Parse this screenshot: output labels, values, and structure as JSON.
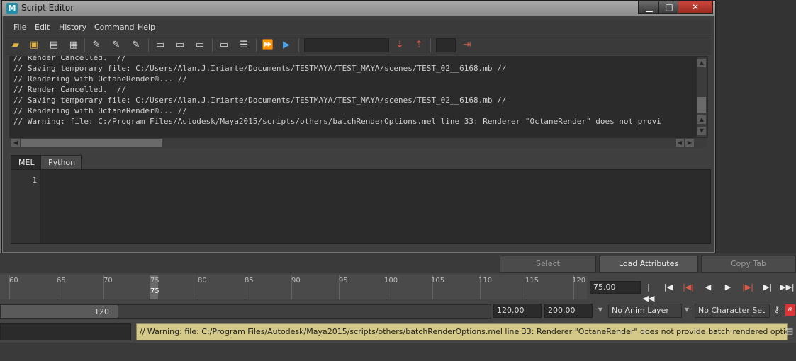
{
  "window": {
    "title": "Script Editor",
    "app_icon": "maya-icon",
    "controls": {
      "minimize": "▁",
      "maximize": "□",
      "close": "✕"
    }
  },
  "menu": [
    "File",
    "Edit",
    "History",
    "Command",
    "Help"
  ],
  "toolbar_icons": [
    "open-script-icon",
    "source-script-icon",
    "save-script-icon",
    "save-script-to-shelf-icon",
    "clear-history-icon",
    "clear-input-icon",
    "clear-all-icon",
    "echo-all-icon",
    "show-line-numbers-icon",
    "show-stack-trace-icon",
    "show-tooltip-help-icon",
    "line-numbers-icon",
    "execute-all-icon",
    "execute-icon",
    "search-down-icon",
    "search-up-icon",
    "goto-line-icon"
  ],
  "history": {
    "lines": [
      "// Render Cancelled.  //",
      "// Saving temporary file: C:/Users/Alan.J.Iriarte/Documents/TESTMAYA/TEST_MAYA/scenes/TEST_02__6168.mb //",
      "// Rendering with OctaneRender®... //",
      "// Render Cancelled.  //",
      "// Saving temporary file: C:/Users/Alan.J.Iriarte/Documents/TESTMAYA/TEST_MAYA/scenes/TEST_02__6168.mb //",
      "// Rendering with OctaneRender®... //",
      "// Warning: file: C:/Program Files/Autodesk/Maya2015/scripts/others/batchRenderOptions.mel line 33: Renderer \"OctaneRender\" does not provi"
    ]
  },
  "tabs": [
    "MEL",
    "Python"
  ],
  "input": {
    "line_number": "1"
  },
  "attribute_buttons": [
    "Select",
    "Load Attributes",
    "Copy Tab"
  ],
  "timeline": {
    "ticks": [
      "60",
      "65",
      "70",
      "75",
      "80",
      "85",
      "90",
      "95",
      "100",
      "105",
      "110",
      "115",
      "120"
    ],
    "current_frame_label": "75",
    "current_frame_value": "75.00"
  },
  "playback_icons": [
    "go-to-start-icon",
    "step-back-key-icon",
    "step-back-frame-icon",
    "play-backwards-icon",
    "play-forwards-icon",
    "step-forward-frame-icon",
    "step-forward-key-icon",
    "go-to-end-icon"
  ],
  "range": {
    "end_label": "120",
    "start_field": "120.00",
    "end_field": "200.00",
    "anim_layer": "No Anim Layer",
    "character_set": "No Character Set"
  },
  "status_line": "// Warning: file: C:/Program Files/Autodesk/Maya2015/scripts/others/batchRenderOptions.mel line 33: Renderer \"OctaneRender\" does not provide batch rendered options."
}
